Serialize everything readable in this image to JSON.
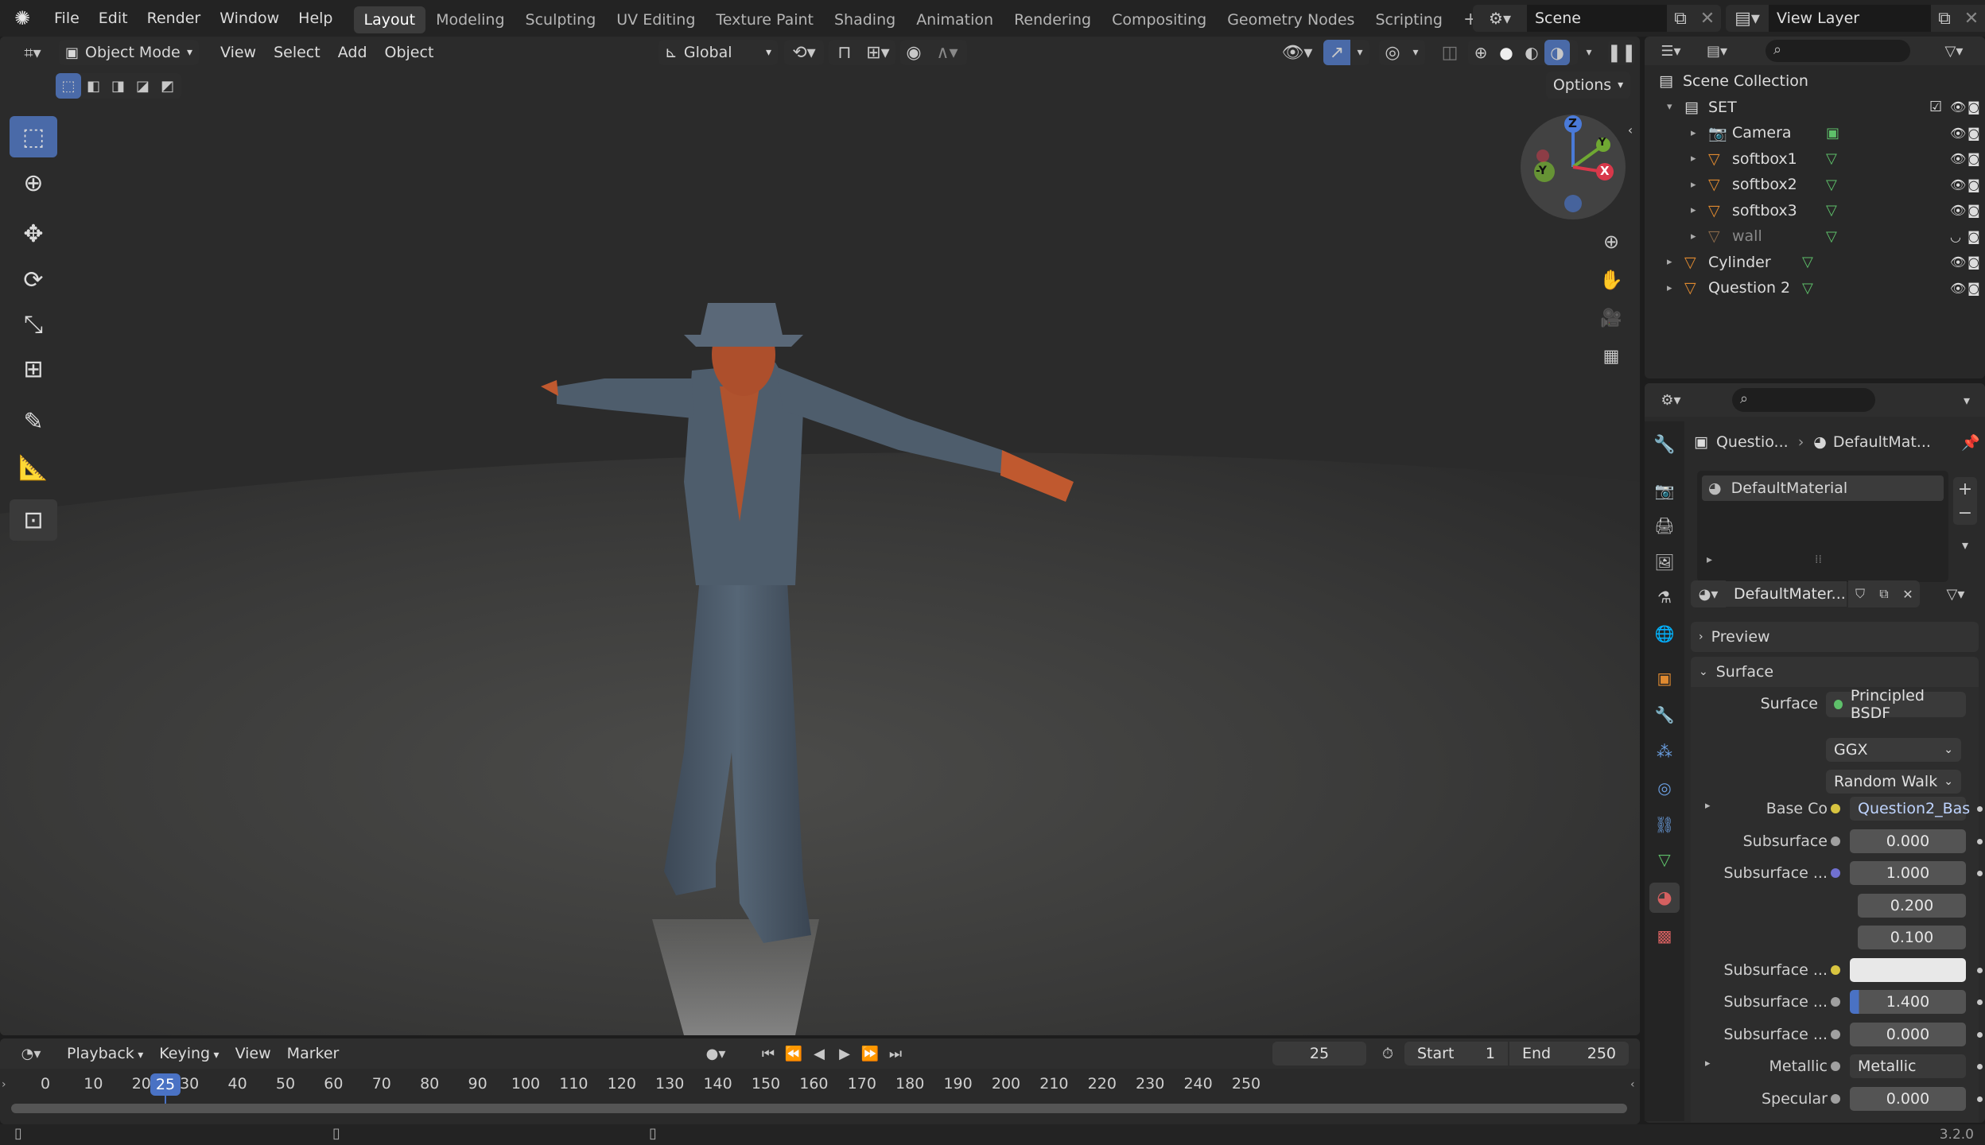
{
  "topbar": {
    "menus": [
      "File",
      "Edit",
      "Render",
      "Window",
      "Help"
    ],
    "workspaces": [
      "Layout",
      "Modeling",
      "Sculpting",
      "UV Editing",
      "Texture Paint",
      "Shading",
      "Animation",
      "Rendering",
      "Compositing",
      "Geometry Nodes",
      "Scripting"
    ],
    "active_workspace": "Layout",
    "add_tab": "+",
    "scene_name": "Scene",
    "view_layer": "View Layer"
  },
  "viewport_header": {
    "mode": "Object Mode",
    "menus": [
      "View",
      "Select",
      "Add",
      "Object"
    ],
    "orientation": "Global",
    "options": "Options"
  },
  "gizmo": {
    "z": "Z",
    "y": "Y",
    "neg_y": "-Y",
    "x": "X"
  },
  "outliner": {
    "root": "Scene Collection",
    "collection": "SET",
    "items": [
      {
        "name": "Camera",
        "icon": "camera-icon",
        "level": 1
      },
      {
        "name": "softbox1",
        "icon": "mesh-icon",
        "level": 1
      },
      {
        "name": "softbox2",
        "icon": "mesh-icon",
        "level": 1
      },
      {
        "name": "softbox3",
        "icon": "mesh-icon",
        "level": 1
      },
      {
        "name": "wall",
        "icon": "mesh-icon",
        "level": 1,
        "hidden": true
      },
      {
        "name": "Cylinder",
        "icon": "mesh-icon",
        "level": 0
      },
      {
        "name": "Question 2",
        "icon": "mesh-icon",
        "level": 0
      }
    ]
  },
  "properties": {
    "breadcrumb_object": "Questio...",
    "breadcrumb_material": "DefaultMat...",
    "material_slot": "DefaultMaterial",
    "material_name": "DefaultMater...",
    "panel_preview": "Preview",
    "panel_surface": "Surface",
    "surface_label": "Surface",
    "surface_value": "Principled BSDF",
    "distribution": "GGX",
    "subsurface_method": "Random Walk",
    "rows": [
      {
        "label": "Base Co",
        "value": "Question2_Bas",
        "dot": "#d8c440",
        "kind": "link",
        "expand": true
      },
      {
        "label": "Subsurface",
        "value": "0.000",
        "dot": "#a0a0a0",
        "kind": "num"
      },
      {
        "label": "Subsurface ...",
        "value": "1.000",
        "dot": "#7070d0",
        "kind": "num"
      },
      {
        "label": "",
        "value": "0.200",
        "dot": "",
        "kind": "num"
      },
      {
        "label": "",
        "value": "0.100",
        "dot": "",
        "kind": "num"
      },
      {
        "label": "Subsurface ...",
        "value": "",
        "dot": "#d8c440",
        "kind": "color"
      },
      {
        "label": "Subsurface ...",
        "value": "1.400",
        "dot": "#a0a0a0",
        "kind": "slider"
      },
      {
        "label": "Subsurface ...",
        "value": "0.000",
        "dot": "#a0a0a0",
        "kind": "num"
      },
      {
        "label": "Metallic",
        "value": "Metallic",
        "dot": "#a0a0a0",
        "kind": "link",
        "expand": true
      },
      {
        "label": "Specular",
        "value": "0.000",
        "dot": "#a0a0a0",
        "kind": "num"
      }
    ]
  },
  "timeline": {
    "menus": [
      "Playback",
      "Keying",
      "View",
      "Marker"
    ],
    "current_frame": "25",
    "start_label": "Start",
    "start": "1",
    "end_label": "End",
    "end": "250",
    "ticks": [
      "0",
      "10",
      "20",
      "30",
      "40",
      "50",
      "60",
      "70",
      "80",
      "90",
      "100",
      "110",
      "120",
      "130",
      "140",
      "150",
      "160",
      "170",
      "180",
      "190",
      "200",
      "210",
      "220",
      "230",
      "240",
      "250"
    ],
    "playhead": "25"
  },
  "statusbar": {
    "version": "3.2.0"
  }
}
